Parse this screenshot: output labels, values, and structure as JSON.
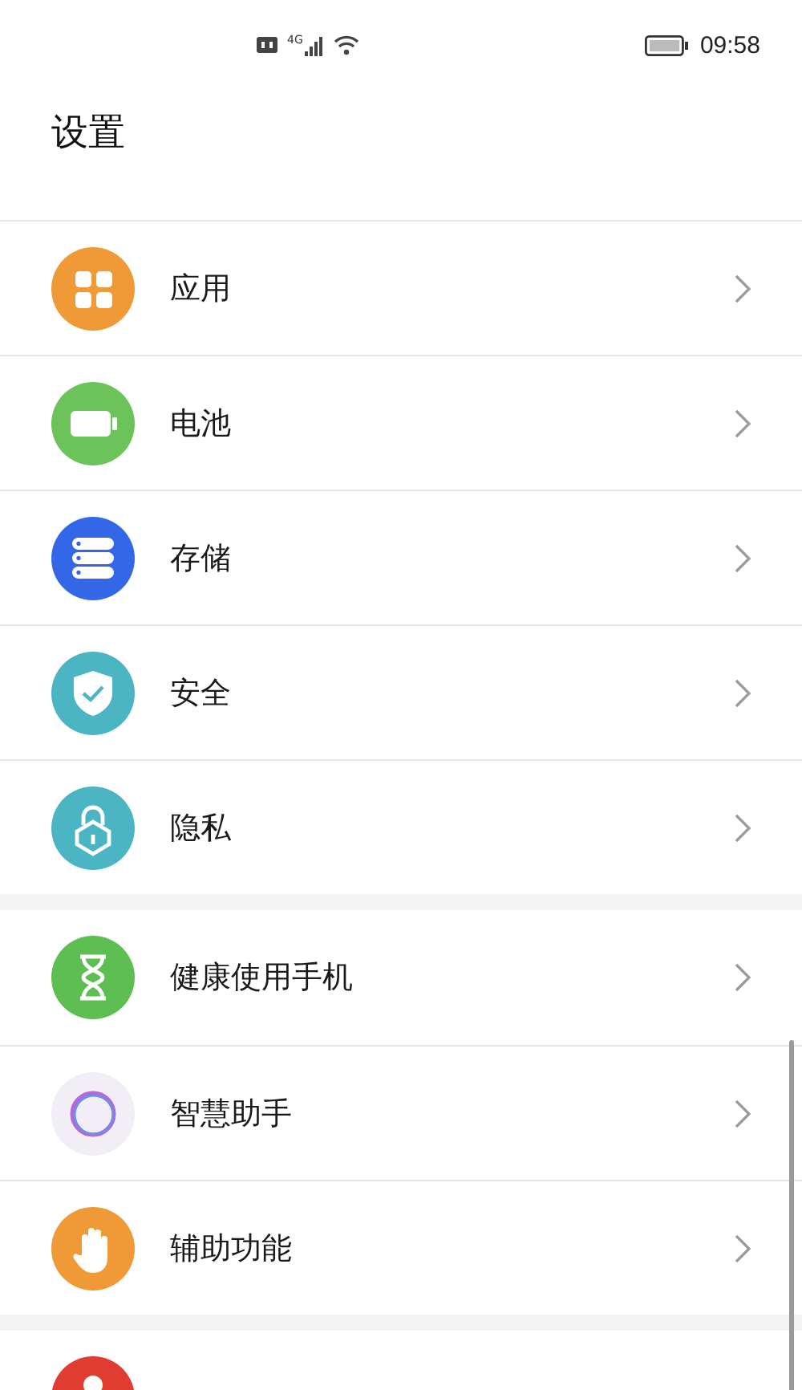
{
  "status_bar": {
    "network": "4G",
    "time": "09:58"
  },
  "title": "设置",
  "groups": [
    {
      "items": [
        {
          "label": "应用",
          "kind": "apps",
          "color": "#f09a37"
        },
        {
          "label": "电池",
          "kind": "battery",
          "color": "#6cc35a"
        },
        {
          "label": "存储",
          "kind": "storage",
          "color": "#3367e8"
        },
        {
          "label": "安全",
          "kind": "shield",
          "color": "#4bb5c4"
        },
        {
          "label": "隐私",
          "kind": "lock",
          "color": "#4bb5c4"
        }
      ]
    },
    {
      "items": [
        {
          "label": "健康使用手机",
          "kind": "hourglass",
          "color": "#5dbf52"
        },
        {
          "label": "智慧助手",
          "kind": "ring",
          "color": "#f1eef6"
        },
        {
          "label": "辅助功能",
          "kind": "hand",
          "color": "#f09a37"
        }
      ]
    },
    {
      "items": [
        {
          "kind": "person",
          "color": "#e03c31"
        }
      ]
    }
  ]
}
